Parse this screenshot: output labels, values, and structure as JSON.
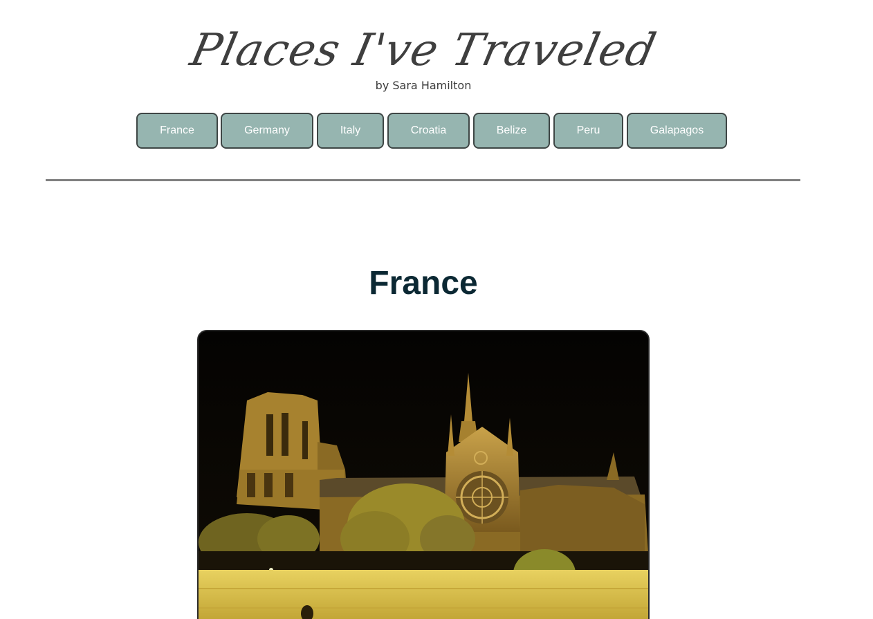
{
  "header": {
    "title": "Places I've Traveled",
    "byline": "by Sara Hamilton"
  },
  "nav": {
    "items": [
      {
        "label": "France"
      },
      {
        "label": "Germany"
      },
      {
        "label": "Italy"
      },
      {
        "label": "Croatia"
      },
      {
        "label": "Belize"
      },
      {
        "label": "Peru"
      },
      {
        "label": "Galapagos"
      }
    ]
  },
  "main": {
    "section_title": "France"
  },
  "colors": {
    "nav_button_bg": "#96b5b0",
    "nav_button_border": "#3e4645",
    "title_text": "#3f3f3f",
    "heading_text": "#0b2833",
    "rule": "#808080"
  }
}
